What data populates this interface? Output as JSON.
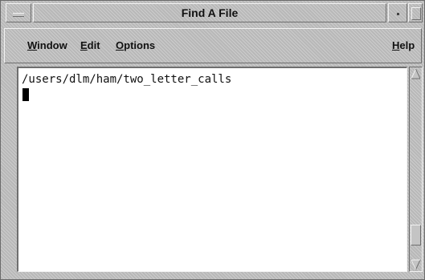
{
  "window": {
    "title": "Find A File"
  },
  "menubar": {
    "items": [
      {
        "mnemonic": "W",
        "rest": "indow"
      },
      {
        "mnemonic": "E",
        "rest": "dit"
      },
      {
        "mnemonic": "O",
        "rest": "ptions"
      }
    ],
    "help": {
      "mnemonic": "H",
      "rest": "elp"
    }
  },
  "textarea": {
    "line1": "/users/dlm/ham/two_letter_calls"
  },
  "scrollbar": {
    "position_fraction": 0.92
  },
  "icons": {
    "window_menu": "window-menu-icon",
    "minimize": "minimize-icon",
    "maximize": "maximize-icon",
    "scroll_up": "scroll-up-arrow-icon",
    "scroll_down": "scroll-down-arrow-icon"
  }
}
